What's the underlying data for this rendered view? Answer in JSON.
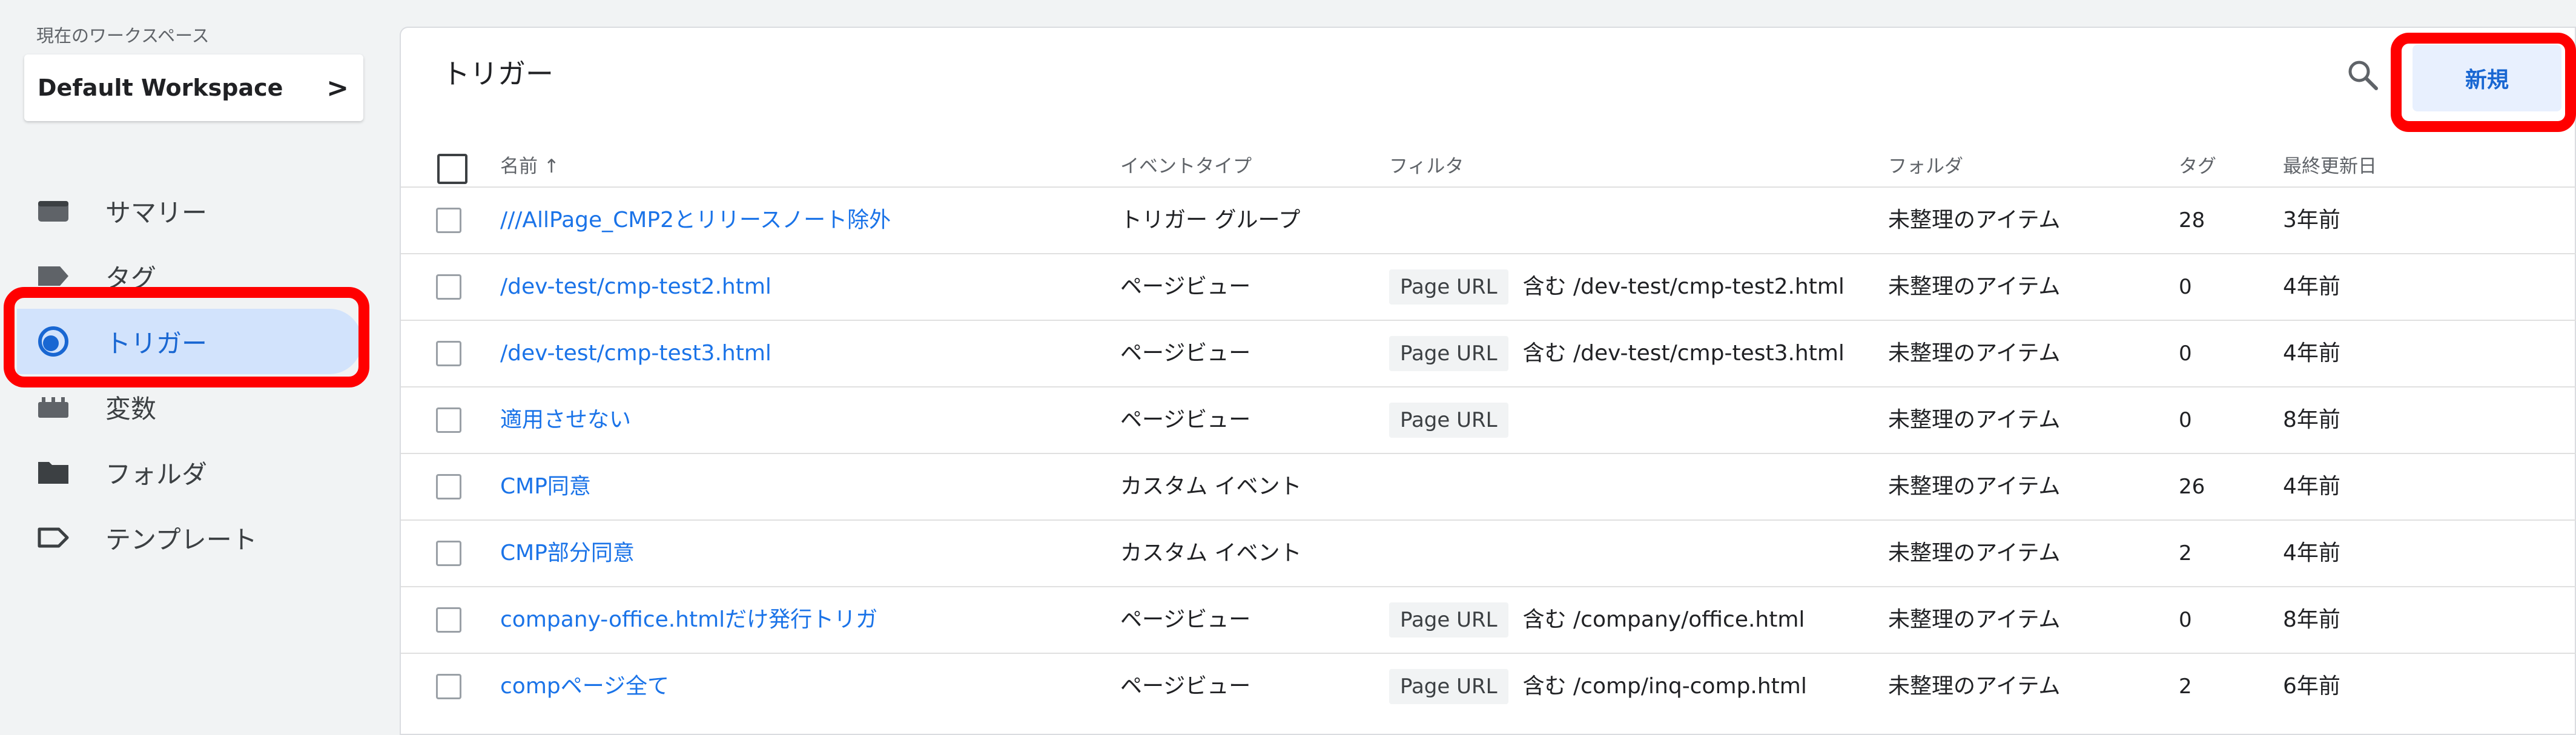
{
  "sidebar": {
    "workspace_caption": "現在のワークスペース",
    "workspace_name": "Default Workspace",
    "items": [
      {
        "label": "サマリー",
        "icon": "summary-icon"
      },
      {
        "label": "タグ",
        "icon": "tag-icon"
      },
      {
        "label": "トリガー",
        "icon": "trigger-icon",
        "active": true
      },
      {
        "label": "変数",
        "icon": "variable-icon"
      },
      {
        "label": "フォルダ",
        "icon": "folder-icon"
      },
      {
        "label": "テンプレート",
        "icon": "template-icon"
      }
    ]
  },
  "main": {
    "title": "トリガー",
    "new_button": "新規",
    "columns": {
      "name": "名前 ↑",
      "event_type": "イベントタイプ",
      "filter": "フィルタ",
      "folder": "フォルダ",
      "tags": "タグ",
      "updated": "最終更新日"
    },
    "rows": [
      {
        "name": "///AllPage_CMP2とリリースノート除外",
        "event_type": "トリガー グループ",
        "filter_chip": "",
        "filter_cond": "",
        "folder": "未整理のアイテム",
        "tags": "28",
        "updated": "3年前"
      },
      {
        "name": "/dev-test/cmp-test2.html",
        "event_type": "ページビュー",
        "filter_chip": "Page URL",
        "filter_cond": "含む /dev-test/cmp-test2.html",
        "folder": "未整理のアイテム",
        "tags": "0",
        "updated": "4年前"
      },
      {
        "name": "/dev-test/cmp-test3.html",
        "event_type": "ページビュー",
        "filter_chip": "Page URL",
        "filter_cond": "含む /dev-test/cmp-test3.html",
        "folder": "未整理のアイテム",
        "tags": "0",
        "updated": "4年前"
      },
      {
        "name": "適用させない",
        "event_type": "ページビュー",
        "filter_chip": "Page URL",
        "filter_cond": "",
        "folder": "未整理のアイテム",
        "tags": "0",
        "updated": "8年前"
      },
      {
        "name": "CMP同意",
        "event_type": "カスタム イベント",
        "filter_chip": "",
        "filter_cond": "",
        "folder": "未整理のアイテム",
        "tags": "26",
        "updated": "4年前"
      },
      {
        "name": "CMP部分同意",
        "event_type": "カスタム イベント",
        "filter_chip": "",
        "filter_cond": "",
        "folder": "未整理のアイテム",
        "tags": "2",
        "updated": "4年前"
      },
      {
        "name": "company-office.htmlだけ発行トリガ",
        "event_type": "ページビュー",
        "filter_chip": "Page URL",
        "filter_cond": "含む /company/office.html",
        "folder": "未整理のアイテム",
        "tags": "0",
        "updated": "8年前"
      },
      {
        "name": "compページ全て",
        "event_type": "ページビュー",
        "filter_chip": "Page URL",
        "filter_cond": "含む /comp/inq-comp.html",
        "folder": "未整理のアイテム",
        "tags": "2",
        "updated": "6年前"
      }
    ]
  },
  "colors": {
    "accent": "#1a73e8",
    "active_nav_bg": "#d2e3fc",
    "highlight": "#ff0000",
    "new_button_bg": "#e8f0fe"
  }
}
